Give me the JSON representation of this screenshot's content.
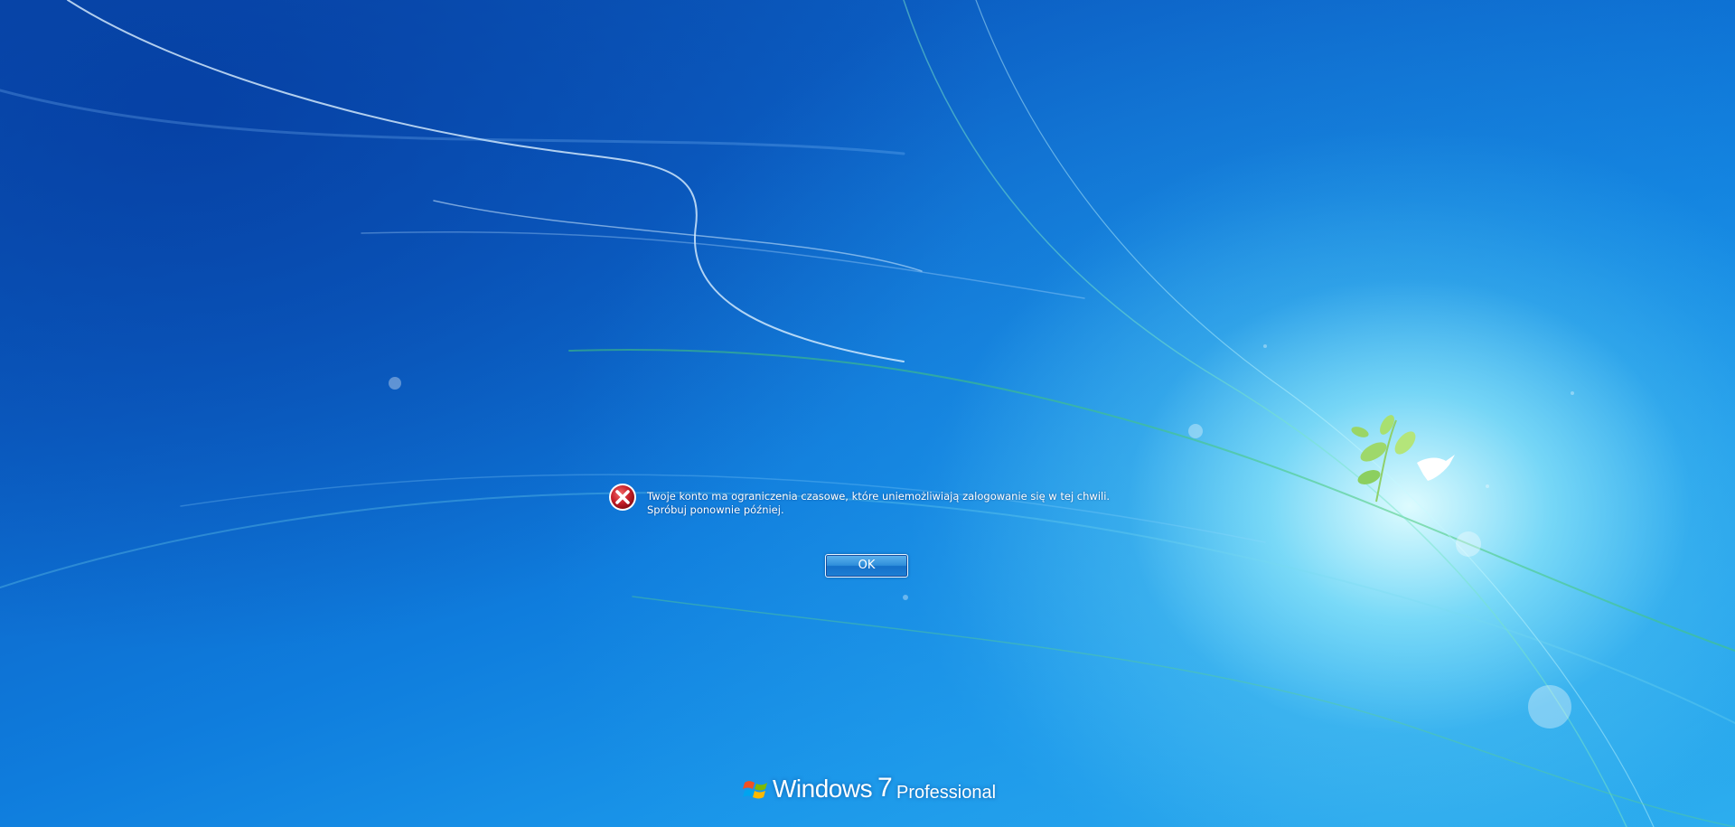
{
  "error": {
    "icon": "error-icon",
    "message": "Twoje konto ma ograniczenia czasowe, które uniemożliwiają zalogowanie się w tej chwili. Spróbuj ponownie później."
  },
  "dialog": {
    "ok_label": "OK"
  },
  "branding": {
    "logo_icon": "windows-flag-icon",
    "name": "Windows",
    "version": "7",
    "edition": "Professional"
  },
  "colors": {
    "background_primary": "#0f7ddd",
    "background_glow": "#bff4ff",
    "error_red": "#c8202a",
    "button_blue": "#2f8fdb"
  }
}
